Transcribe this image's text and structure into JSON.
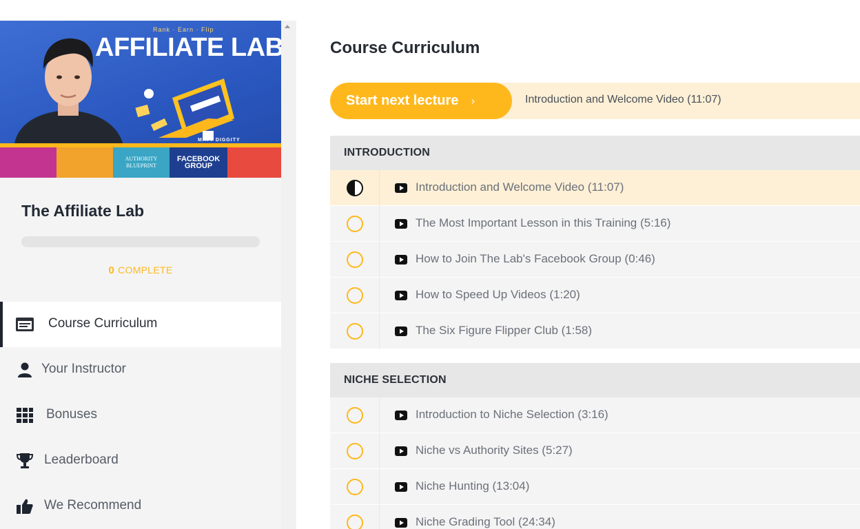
{
  "sidebar": {
    "banner": {
      "tagline": "Rank · Earn · Flip",
      "title": "AFFILIATE LAB",
      "author": "MATT DIGGITY",
      "tiles": [
        {
          "label": "",
          "color": "#c2348f"
        },
        {
          "label": "",
          "color": "#f2a32b"
        },
        {
          "label": "AUTHORITY BLUEPRINT",
          "color": "#3aa5c4"
        },
        {
          "label": "FACEBOOK GROUP",
          "color": "#1e3f8f"
        },
        {
          "label": "",
          "color": "#e84a3f"
        }
      ]
    },
    "course_title": "The Affiliate Lab",
    "progress": {
      "percent": 0,
      "count": "0",
      "label": "COMPLETE"
    },
    "nav": [
      {
        "label": "Course Curriculum",
        "icon": "curriculum-icon",
        "active": true
      },
      {
        "label": "Your Instructor",
        "icon": "user-icon",
        "active": false
      },
      {
        "label": "Bonuses",
        "icon": "grid-icon",
        "active": false
      },
      {
        "label": "Leaderboard",
        "icon": "trophy-icon",
        "active": false
      },
      {
        "label": "We Recommend",
        "icon": "thumbs-up-icon",
        "active": false
      }
    ]
  },
  "main": {
    "title": "Course Curriculum",
    "next": {
      "button_label": "Start next lecture",
      "chevron": "›",
      "lecture_title": "Introduction and Welcome Video (11:07)"
    },
    "sections": [
      {
        "title": "INTRODUCTION",
        "lectures": [
          {
            "title": "Introduction and Welcome Video (11:07)",
            "status": "in-progress"
          },
          {
            "title": "The Most Important Lesson in this Training (5:16)",
            "status": "not-started"
          },
          {
            "title": "How to Join The Lab's Facebook Group (0:46)",
            "status": "not-started"
          },
          {
            "title": "How to Speed Up Videos (1:20)",
            "status": "not-started"
          },
          {
            "title": "The Six Figure Flipper Club (1:58)",
            "status": "not-started"
          }
        ]
      },
      {
        "title": "NICHE SELECTION",
        "lectures": [
          {
            "title": "Introduction to Niche Selection (3:16)",
            "status": "not-started"
          },
          {
            "title": "Niche vs Authority Sites (5:27)",
            "status": "not-started"
          },
          {
            "title": "Niche Hunting (13:04)",
            "status": "not-started"
          },
          {
            "title": "Niche Grading Tool (24:34)",
            "status": "not-started"
          }
        ]
      }
    ]
  },
  "colors": {
    "accent": "#ffb81c",
    "accent_soft": "#fdf0d6",
    "banner_blue": "#2f5fc8",
    "text_dark": "#262b33"
  }
}
